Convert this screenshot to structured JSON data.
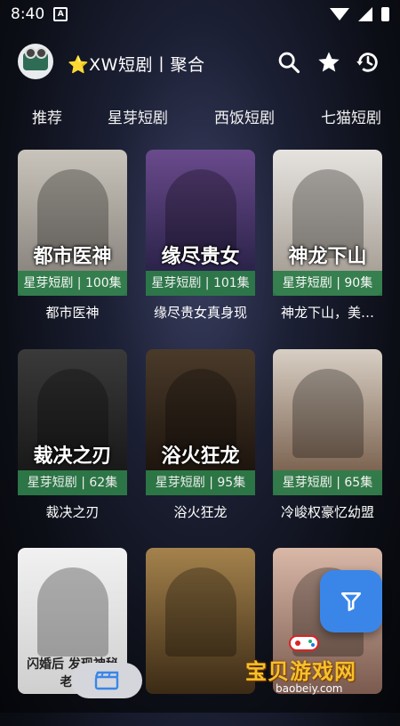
{
  "status_bar": {
    "time": "8:40",
    "app_glyph": "A"
  },
  "header": {
    "title": "⭐XW短剧丨聚合"
  },
  "tabs": [
    "推荐",
    "星芽短剧",
    "西饭短剧",
    "七猫短剧"
  ],
  "cards": [
    {
      "poster_text": "都市医神",
      "badge": "星芽短剧 | 100集",
      "caption": "都市医神",
      "colors": [
        "#c9c4bb",
        "#7f7a74"
      ]
    },
    {
      "poster_text": "缘尽贵女",
      "badge": "星芽短剧 | 101集",
      "caption": "缘尽贵女真身现",
      "colors": [
        "#6a4a8c",
        "#1e1b3c"
      ]
    },
    {
      "poster_text": "神龙下山",
      "badge": "星芽短剧 | 90集",
      "caption": "神龙下山，美…",
      "colors": [
        "#e6e3df",
        "#9c948a"
      ]
    },
    {
      "poster_text": "裁决之刃",
      "badge": "星芽短剧 | 62集",
      "caption": "裁决之刃",
      "colors": [
        "#3a3a3a",
        "#121212"
      ]
    },
    {
      "poster_text": "浴火狂龙",
      "badge": "星芽短剧 | 95集",
      "caption": "浴火狂龙",
      "colors": [
        "#4a3a2a",
        "#140d08"
      ]
    },
    {
      "poster_text": "",
      "badge": "星芽短剧 | 65集",
      "caption": "冷峻权豪忆幼盟",
      "colors": [
        "#d8cfc4",
        "#6b4f3b"
      ]
    },
    {
      "poster_text": "闪婚后 发现神秘老公",
      "badge": "",
      "caption": "",
      "colors": [
        "#f1f1f1",
        "#cfcfcf"
      ]
    },
    {
      "poster_text": "",
      "badge": "",
      "caption": "",
      "colors": [
        "#a4824c",
        "#3b2a15"
      ]
    },
    {
      "poster_text": "",
      "badge": "",
      "caption": "",
      "colors": [
        "#d9b8a8",
        "#7a5a4e"
      ]
    }
  ],
  "watermark": {
    "text": "宝贝游戏网",
    "url": "baobeiy.com"
  },
  "theme": {
    "fab_color": "#3a86e8",
    "badge_color": "#2e7d4a"
  }
}
